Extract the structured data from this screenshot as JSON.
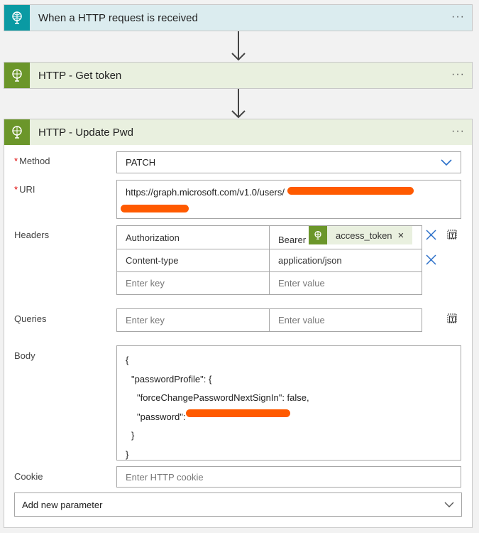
{
  "cards": [
    {
      "title": "When a HTTP request is received",
      "color": "#0a9aa3",
      "header_bg": "#dbecef"
    },
    {
      "title": "HTTP - Get token",
      "color": "#6b962a",
      "header_bg": "#e9f0df"
    },
    {
      "title": "HTTP - Update Pwd",
      "color": "#6b962a",
      "header_bg": "#e9f0df"
    }
  ],
  "more": "···",
  "form": {
    "method_label": "Method",
    "method_value": "PATCH",
    "uri_label": "URI",
    "uri_value": "https://graph.microsoft.com/v1.0/users/",
    "headers_label": "Headers",
    "headers": [
      {
        "key": "Authorization",
        "value_prefix": "Bearer",
        "token": "access_token",
        "token_remove": "×"
      },
      {
        "key": "Content-type",
        "value": "application/json"
      }
    ],
    "key_placeholder": "Enter key",
    "value_placeholder": "Enter value",
    "queries_label": "Queries",
    "body_label": "Body",
    "body_lines": [
      "{",
      "\"passwordProfile\": {",
      "\"forceChangePasswordNextSignIn\": false,",
      "\"password\":",
      "}",
      "}"
    ],
    "cookie_label": "Cookie",
    "cookie_placeholder": "Enter HTTP cookie",
    "add_param": "Add new parameter",
    "required_mark": "*"
  }
}
